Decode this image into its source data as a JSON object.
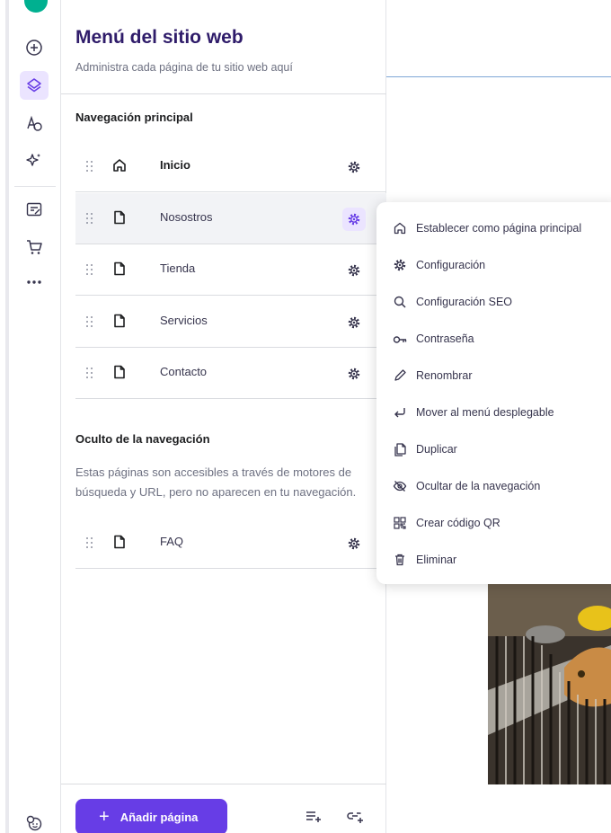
{
  "panel": {
    "title": "Menú del sitio web",
    "subtitle": "Administra cada página de tu sitio web aquí"
  },
  "main_nav": {
    "title": "Navegación principal",
    "pages": [
      {
        "label": "Inicio",
        "icon": "home-icon",
        "home": true
      },
      {
        "label": "Nosostros",
        "icon": "page-icon",
        "home": false
      },
      {
        "label": "Tienda",
        "icon": "page-icon",
        "home": false
      },
      {
        "label": "Servicios",
        "icon": "page-icon",
        "home": false
      },
      {
        "label": "Contacto",
        "icon": "page-icon",
        "home": false
      }
    ]
  },
  "hidden_nav": {
    "title": "Oculto de la navegación",
    "description": "Estas páginas son accesibles a través de motores de búsqueda y URL, pero no aparecen en tu navegación.",
    "pages": [
      {
        "label": "FAQ",
        "icon": "page-icon"
      }
    ]
  },
  "footer": {
    "add_page_label": "Añadir página"
  },
  "context_menu": {
    "items": [
      {
        "label": "Establecer como página principal",
        "icon": "home-icon"
      },
      {
        "label": "Configuración",
        "icon": "gear-icon"
      },
      {
        "label": "Configuración SEO",
        "icon": "search-icon"
      },
      {
        "label": "Contraseña",
        "icon": "key-icon"
      },
      {
        "label": "Renombrar",
        "icon": "pencil-icon"
      },
      {
        "label": "Mover al menú desplegable",
        "icon": "return-arrow-icon"
      },
      {
        "label": "Duplicar",
        "icon": "duplicate-icon"
      },
      {
        "label": "Ocultar de la navegación",
        "icon": "eye-off-icon"
      },
      {
        "label": "Crear código QR",
        "icon": "qr-code-icon"
      },
      {
        "label": "Eliminar",
        "icon": "trash-icon"
      }
    ]
  },
  "colors": {
    "accent": "#673de6",
    "accent_light": "#ebe4ff",
    "title": "#2f1c6a"
  }
}
